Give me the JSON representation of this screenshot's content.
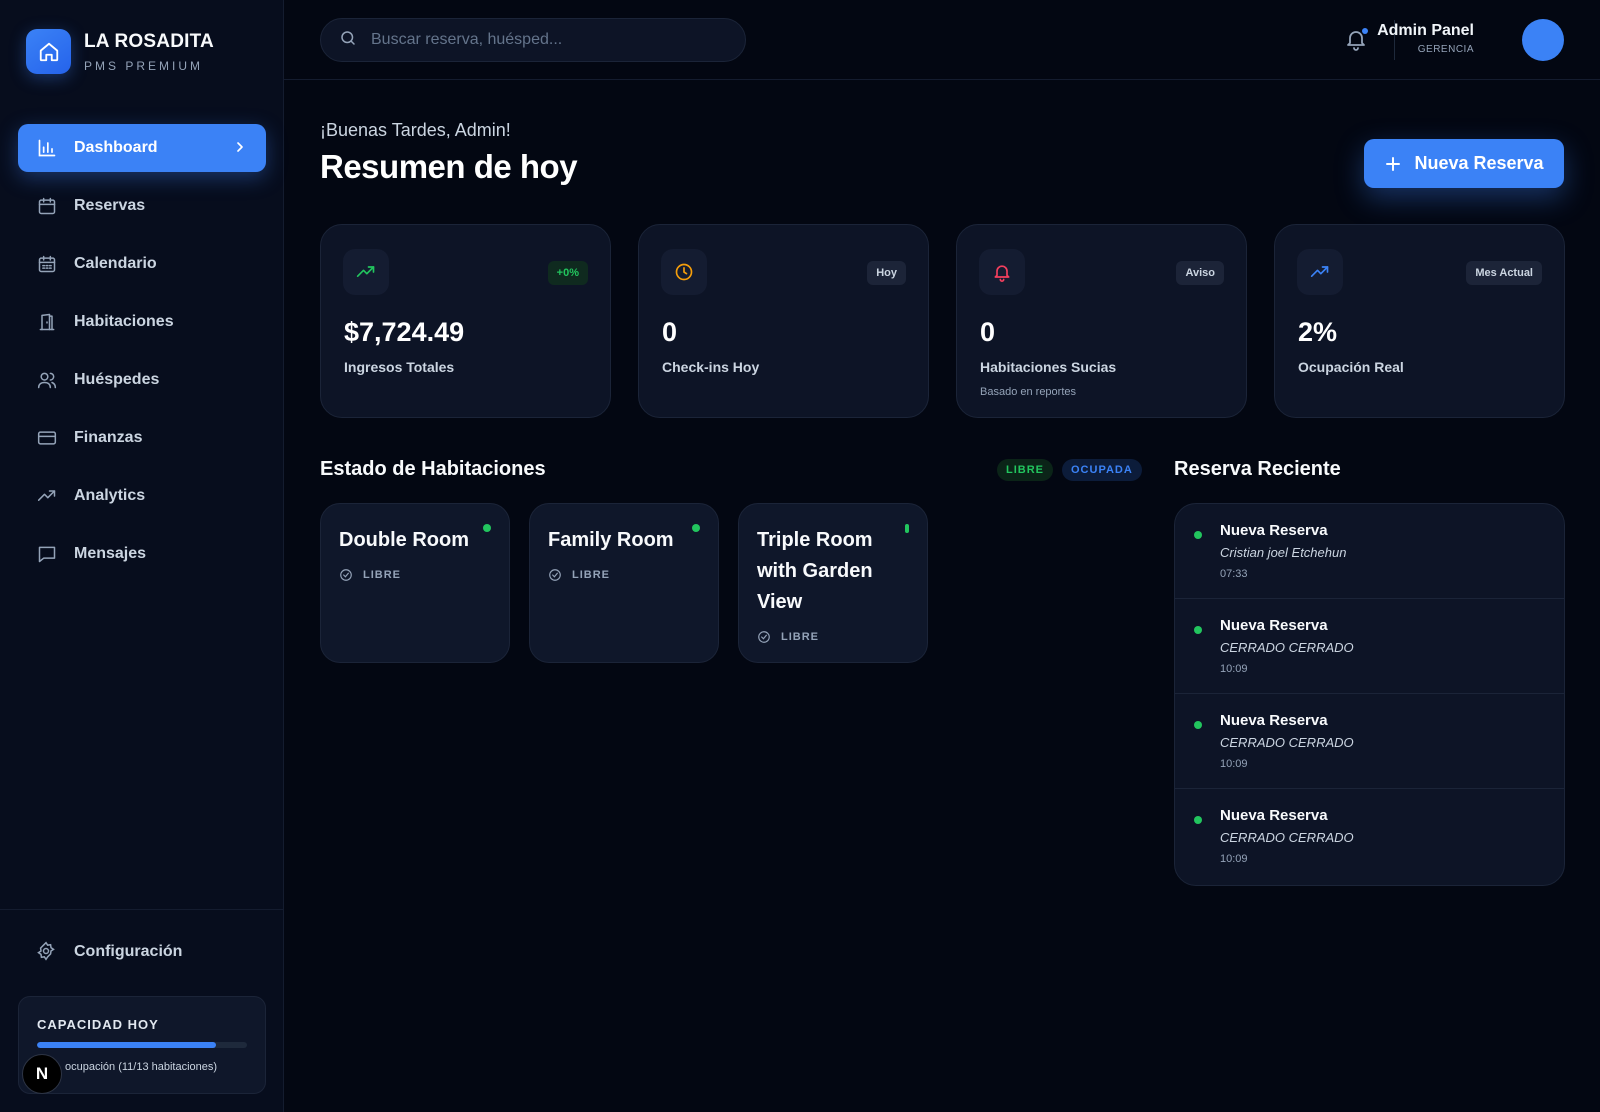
{
  "brand": {
    "title": "LA ROSADITA",
    "subtitle": "PMS PREMIUM"
  },
  "sidebar": {
    "items": [
      {
        "label": "Dashboard",
        "icon": "bar-chart-icon",
        "active": true
      },
      {
        "label": "Reservas",
        "icon": "calendar-icon"
      },
      {
        "label": "Calendario",
        "icon": "calendar-grid-icon"
      },
      {
        "label": "Habitaciones",
        "icon": "door-icon"
      },
      {
        "label": "Huéspedes",
        "icon": "users-icon"
      },
      {
        "label": "Finanzas",
        "icon": "credit-card-icon"
      },
      {
        "label": "Analytics",
        "icon": "trending-up-icon"
      },
      {
        "label": "Mensajes",
        "icon": "message-icon"
      }
    ],
    "config_label": "Configuración",
    "capacity": {
      "title": "CAPACIDAD HOY",
      "fill_percent": 85,
      "text": "ocupación (11/13 habitaciones)"
    },
    "n_badge": "N"
  },
  "header": {
    "search_placeholder": "Buscar reserva, huésped...",
    "user_name": "Admin Panel",
    "user_role": "GERENCIA"
  },
  "main": {
    "greeting": "¡Buenas Tardes, Admin!",
    "title": "Resumen de hoy",
    "new_button": "Nueva Reserva"
  },
  "stats": [
    {
      "value": "$7,724.49",
      "label": "Ingresos Totales",
      "badge": "+0%",
      "icon": "trending-up-icon",
      "icon_color": "#22c55e"
    },
    {
      "value": "0",
      "label": "Check-ins Hoy",
      "badge": "Hoy",
      "icon": "clock-icon",
      "icon_color": "#f59e0b"
    },
    {
      "value": "0",
      "label": "Habitaciones Sucias",
      "badge": "Aviso",
      "note": "Basado en reportes",
      "icon": "bell-icon",
      "icon_color": "#f43f5e"
    },
    {
      "value": "2%",
      "label": "Ocupación Real",
      "badge": "Mes Actual",
      "icon": "trending-up-icon",
      "icon_color": "#3b82f6"
    }
  ],
  "rooms_section": {
    "title": "Estado de Habitaciones",
    "legend_libre": "LIBRE",
    "legend_ocupada": "OCUPADA",
    "rooms": [
      {
        "name": "Double Room",
        "status": "LIBRE"
      },
      {
        "name": "Family Room",
        "status": "LIBRE"
      },
      {
        "name": "Triple Room with Garden View",
        "status": "LIBRE"
      }
    ]
  },
  "recent": {
    "title": "Reserva Reciente",
    "items": [
      {
        "title": "Nueva Reserva",
        "guest": "Cristian joel Etchehun",
        "time": "07:33"
      },
      {
        "title": "Nueva Reserva",
        "guest": "CERRADO CERRADO",
        "time": "10:09"
      },
      {
        "title": "Nueva Reserva",
        "guest": "CERRADO CERRADO",
        "time": "10:09"
      },
      {
        "title": "Nueva Reserva",
        "guest": "CERRADO CERRADO",
        "time": "10:09"
      }
    ]
  },
  "colors": {
    "accent": "#3b82f6",
    "success": "#22c55e",
    "warning": "#f59e0b",
    "danger": "#f43f5e",
    "background": "#030712"
  }
}
